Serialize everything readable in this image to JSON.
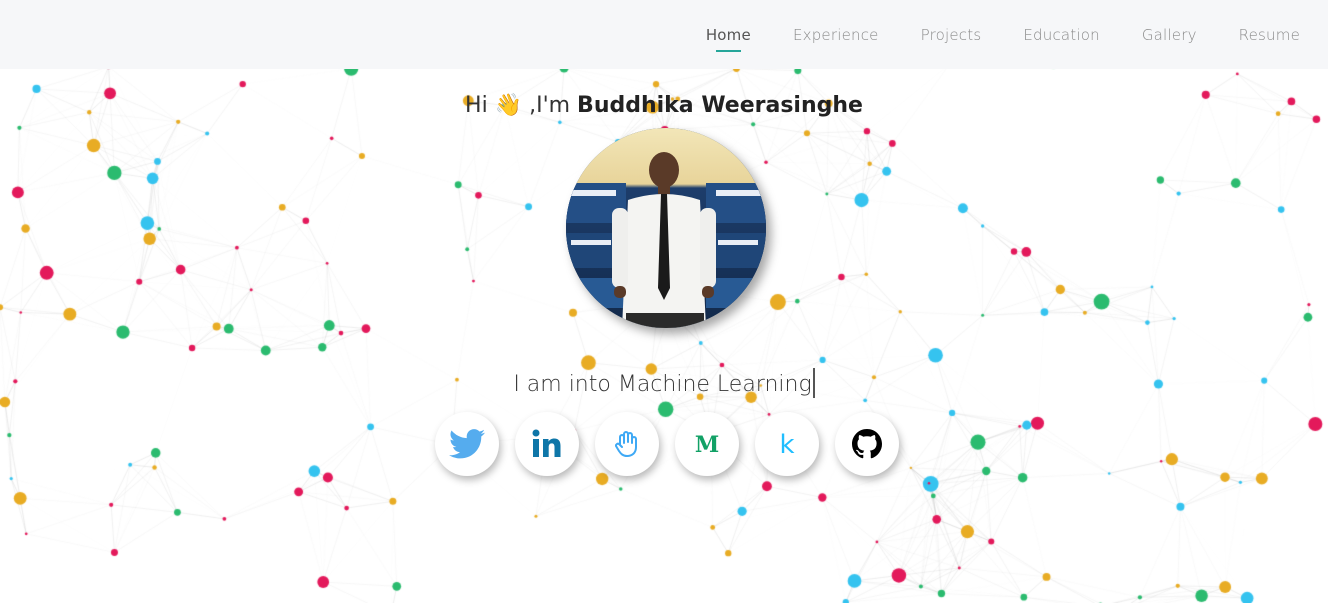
{
  "nav": {
    "items": [
      {
        "label": "Home",
        "active": true
      },
      {
        "label": "Experience",
        "active": false
      },
      {
        "label": "Projects",
        "active": false
      },
      {
        "label": "Education",
        "active": false
      },
      {
        "label": "Gallery",
        "active": false
      },
      {
        "label": "Resume",
        "active": false
      }
    ]
  },
  "hero": {
    "greeting_prefix": "Hi ",
    "wave_emoji": "👋",
    "greeting_mid": " ,I'm ",
    "name": "Buddhika Weerasinghe",
    "tagline": "I am into Machine Learning",
    "avatar_icon": "profile-photo"
  },
  "socials": [
    {
      "name": "twitter",
      "icon": "twitter-icon",
      "color": "#55acee"
    },
    {
      "name": "linkedin",
      "icon": "linkedin-icon",
      "color": "#0e76a8"
    },
    {
      "name": "hackster",
      "icon": "hand-icon",
      "color": "#3fa9f5"
    },
    {
      "name": "medium",
      "icon": "medium-icon",
      "color": "#12a166"
    },
    {
      "name": "kaggle",
      "icon": "kaggle-icon",
      "color": "#20beff"
    },
    {
      "name": "github",
      "icon": "github-icon",
      "color": "#000000"
    }
  ],
  "colors": {
    "accent": "#26a69a",
    "particles": [
      "#e3195b",
      "#e8ac24",
      "#2bbb6f",
      "#35c3ef"
    ]
  }
}
